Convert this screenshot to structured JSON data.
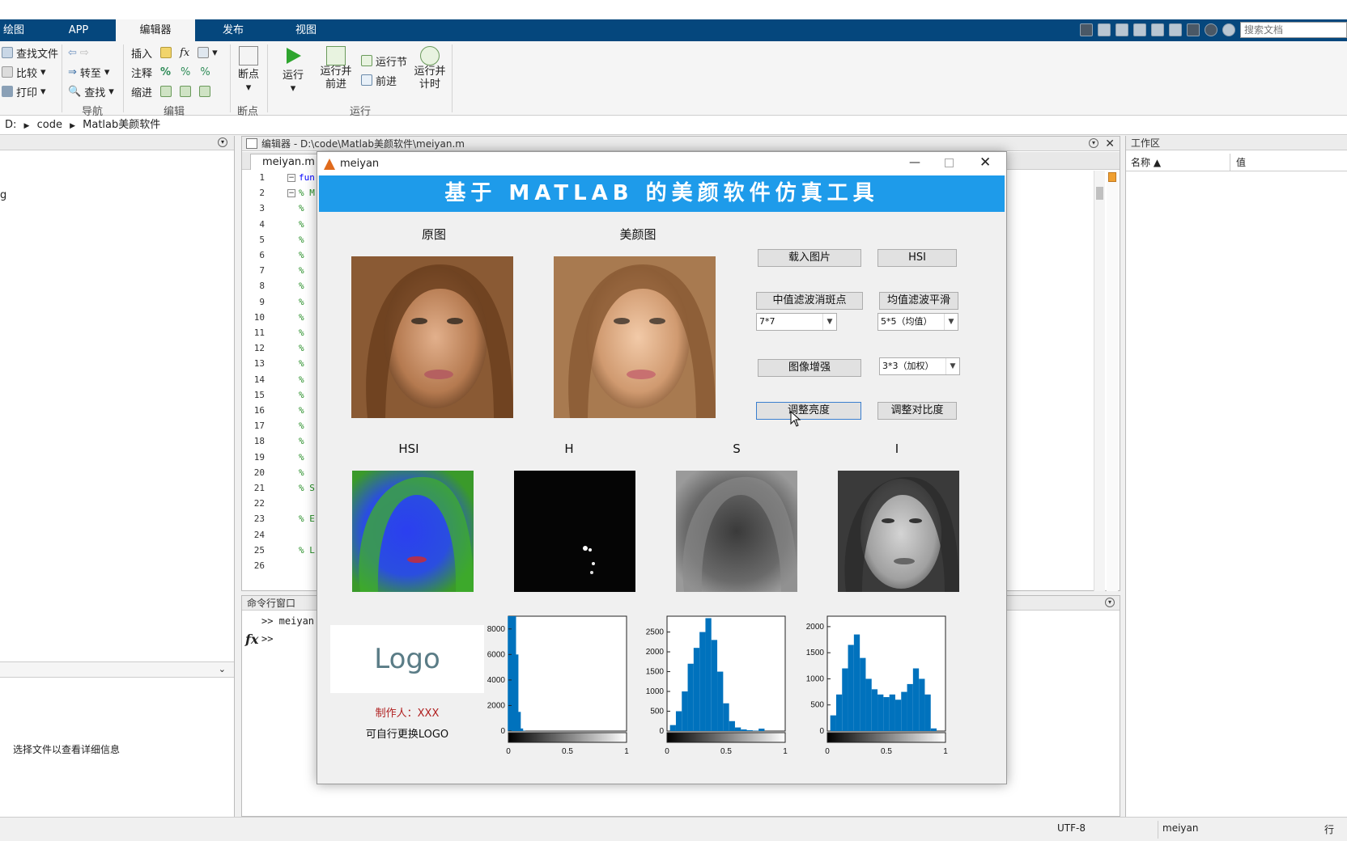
{
  "ribbon": {
    "tabs": [
      "绘图",
      "APP",
      "编辑器",
      "发布",
      "视图"
    ],
    "active_tab": "编辑器",
    "search_placeholder": "搜索文档",
    "nav": {
      "find_files": "查找文件",
      "compare": "比较",
      "print": "打印",
      "goto": "转至",
      "find": "查找",
      "label": "导航"
    },
    "edit": {
      "insert": "插入",
      "comment": "注释",
      "indent": "缩进",
      "label": "编辑",
      "fx": "fx"
    },
    "breakpoints": {
      "btn": "断点",
      "label": "断点"
    },
    "run": {
      "run": "运行",
      "run_advance_1": "运行并",
      "run_advance_2": "前进",
      "run_section": "运行节",
      "advance": "前进",
      "run_time_1": "运行并",
      "run_time_2": "计时",
      "label": "运行"
    }
  },
  "address": {
    "parts": [
      "D:",
      "code",
      "Matlab美颜软件"
    ]
  },
  "left_panel": {
    "fragment_1": "g",
    "detail_hint": "选择文件以查看详细信息"
  },
  "editor": {
    "title": "编辑器 - D:\\code\\Matlab美颜软件\\meiyan.m",
    "tab": "meiyan.m",
    "line_numbers": [
      "1",
      "2",
      "3",
      "4",
      "5",
      "6",
      "7",
      "8",
      "9",
      "10",
      "11",
      "12",
      "13",
      "14",
      "15",
      "16",
      "17",
      "18",
      "19",
      "20",
      "21",
      "22",
      "23",
      "24",
      "25",
      "26"
    ],
    "code": [
      "fun",
      "% M",
      "%",
      "%",
      "%",
      "%",
      "%",
      "%",
      "%",
      "%",
      "%",
      "%",
      "%",
      "%",
      "%",
      "%",
      "%",
      "%",
      "%",
      "%",
      "% S",
      "",
      "% E",
      "",
      "% L",
      ""
    ]
  },
  "command_window": {
    "title": "命令行窗口",
    "line1": ">> meiyan",
    "prompt": ">>",
    "fx": "fx"
  },
  "workspace": {
    "title": "工作区",
    "col_name": "名称 ▲",
    "col_value": "值"
  },
  "status": {
    "encoding": "UTF-8",
    "file": "meiyan",
    "pos": "行"
  },
  "figure": {
    "window_title": "meiyan",
    "banner": "基于 MATLAB 的美颜软件仿真工具",
    "original_title": "原图",
    "beauty_title": "美颜图",
    "load_btn": "载入图片",
    "hsi_btn": "HSI",
    "median_btn": "中值滤波消斑点",
    "mean_btn": "均值滤波平滑",
    "median_sel": "7*7",
    "mean_sel": "5*5（均值）",
    "enhance_btn": "图像增强",
    "enhance_sel": "3*3（加权）",
    "brightness_btn": "调整亮度",
    "contrast_btn": "调整对比度",
    "hsi_title": "HSI",
    "h_title": "H",
    "s_title": "S",
    "i_title": "I",
    "logo_text": "Logo",
    "author_label": "制作人：",
    "author_name": "XXX",
    "logo_hint": "可自行更换LOGO"
  },
  "chart_data": [
    {
      "type": "bar",
      "title": "",
      "xlim": [
        0,
        1
      ],
      "ylim": [
        0,
        9000
      ],
      "yticks": [
        0,
        2000,
        4000,
        6000,
        8000
      ],
      "xticks": [
        0,
        0.5,
        1
      ],
      "x": [
        0.02,
        0.04,
        0.06,
        0.08,
        0.1,
        0.12
      ],
      "values": [
        9000,
        9000,
        6000,
        1500,
        200,
        30
      ],
      "color": "#0072bd"
    },
    {
      "type": "bar",
      "title": "",
      "xlim": [
        0,
        1
      ],
      "ylim": [
        0,
        2900
      ],
      "yticks": [
        0,
        500,
        1000,
        1500,
        2000,
        2500
      ],
      "xticks": [
        0,
        0.5,
        1
      ],
      "x": [
        0.05,
        0.1,
        0.15,
        0.2,
        0.25,
        0.3,
        0.35,
        0.4,
        0.45,
        0.5,
        0.55,
        0.6,
        0.65,
        0.7,
        0.75,
        0.8
      ],
      "values": [
        150,
        500,
        1000,
        1700,
        2100,
        2500,
        2850,
        2300,
        1500,
        700,
        250,
        90,
        40,
        20,
        10,
        60
      ],
      "color": "#0072bd"
    },
    {
      "type": "bar",
      "title": "",
      "xlim": [
        0,
        1
      ],
      "ylim": [
        0,
        2200
      ],
      "yticks": [
        0,
        500,
        1000,
        1500,
        2000
      ],
      "xticks": [
        0,
        0.5,
        1
      ],
      "x": [
        0.05,
        0.1,
        0.15,
        0.2,
        0.25,
        0.3,
        0.35,
        0.4,
        0.45,
        0.5,
        0.55,
        0.6,
        0.65,
        0.7,
        0.75,
        0.8,
        0.85,
        0.9
      ],
      "values": [
        300,
        700,
        1200,
        1650,
        1850,
        1400,
        1000,
        800,
        700,
        650,
        700,
        600,
        750,
        900,
        1200,
        1000,
        700,
        50
      ],
      "color": "#0072bd"
    }
  ]
}
